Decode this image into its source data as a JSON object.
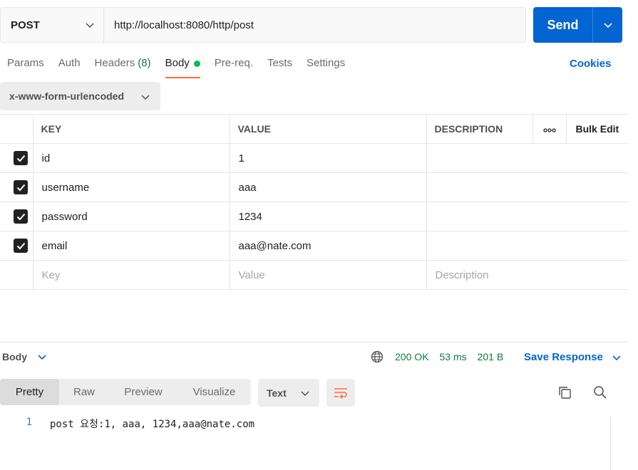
{
  "request": {
    "method": "POST",
    "url": "http://localhost:8080/http/post",
    "send_label": "Send"
  },
  "tabs": [
    {
      "label": "Params"
    },
    {
      "label": "Auth"
    },
    {
      "label": "Headers",
      "count": "(8)"
    },
    {
      "label": "Body",
      "active": true
    },
    {
      "label": "Pre-req."
    },
    {
      "label": "Tests"
    },
    {
      "label": "Settings"
    }
  ],
  "cookies_label": "Cookies",
  "body_type": "x-www-form-urlencoded",
  "table": {
    "headers": {
      "key": "KEY",
      "value": "VALUE",
      "description": "DESCRIPTION",
      "bulk_edit": "Bulk Edit"
    },
    "rows": [
      {
        "key": "id",
        "value": "1",
        "checked": true
      },
      {
        "key": "username",
        "value": "aaa",
        "checked": true
      },
      {
        "key": "password",
        "value": "1234",
        "checked": true
      },
      {
        "key": "email",
        "value": "aaa@nate.com",
        "checked": true
      }
    ],
    "placeholders": {
      "key": "Key",
      "value": "Value",
      "description": "Description"
    }
  },
  "response": {
    "section_label": "Body",
    "status": "200 OK",
    "time": "53 ms",
    "size": "201 B",
    "save_label": "Save Response",
    "view_tabs": [
      "Pretty",
      "Raw",
      "Preview",
      "Visualize"
    ],
    "active_view": "Pretty",
    "format": "Text",
    "lines": [
      {
        "number": "1",
        "text": "post 요청:1, aaa, 1234,aaa@nate.com"
      }
    ]
  },
  "colors": {
    "accent": "#ff6c37",
    "primary": "#0265d2",
    "success": "#0f7a3c"
  }
}
